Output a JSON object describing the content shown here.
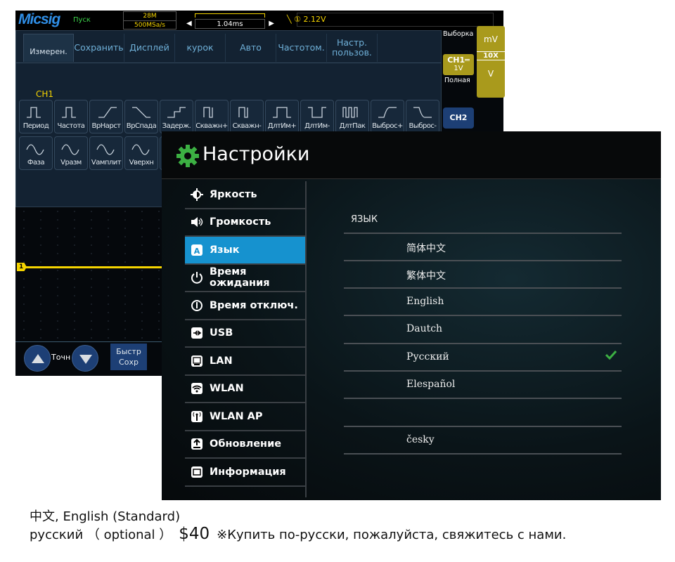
{
  "scope": {
    "brand": "Micsig",
    "run_state": "Пуск",
    "memory": "28M",
    "sample_rate": "500MSa/s",
    "timebase": "1.04ms",
    "trigger": "① 2.12V",
    "tabs": [
      "Измерен.",
      "Сохранить",
      "Дисплей",
      "курок",
      "Авто",
      "Частотом.",
      "Настр. пользов."
    ],
    "channel_label": "CH1",
    "measurements_row1": [
      "Период",
      "Частота",
      "ВрНарст",
      "ВрСпада",
      "Задерж.",
      "Скважн+",
      "Скважн-",
      "ДлтИм+",
      "ДлтИм-",
      "ДлтПак",
      "Выброс+",
      "Выброс-"
    ],
    "measurements_row2": [
      "Фаза",
      "Vразм",
      "Vамплит",
      "Vверхн"
    ],
    "side": {
      "acq_label": "Выборка",
      "ch1": "CH1═",
      "ch1_scale": "1V",
      "bandwidth": "Полная",
      "unit_top": "mV",
      "probe": "10X",
      "unit_bottom": "V",
      "ch2": "CH2"
    },
    "trace_marker": "1",
    "fine_label": "Точн",
    "quick_save": "Быстр Сохр",
    "colors": {
      "ch1": "#f5d400",
      "accent_blue": "#1d3f75"
    }
  },
  "settings": {
    "title": "Настройки",
    "menu": [
      {
        "label": "Яркость",
        "icon": "brightness-icon"
      },
      {
        "label": "Громкость",
        "icon": "volume-icon"
      },
      {
        "label": "Язык",
        "icon": "language-icon",
        "selected": true
      },
      {
        "label": "Время ожидания",
        "icon": "power-icon"
      },
      {
        "label": "Время отключ.",
        "icon": "shutdown-icon"
      },
      {
        "label": "USB",
        "icon": "usb-icon"
      },
      {
        "label": "LAN",
        "icon": "lan-icon"
      },
      {
        "label": "WLAN",
        "icon": "wifi-icon"
      },
      {
        "label": "WLAN AP",
        "icon": "hotspot-icon"
      },
      {
        "label": "Обновление",
        "icon": "update-icon"
      },
      {
        "label": "Информация",
        "icon": "info-icon"
      }
    ],
    "language_header": "ЯЗЫК",
    "languages": [
      "简体中文",
      "繁体中文",
      "English",
      "Dautch",
      "Русский",
      "Elespañol",
      "",
      "česky"
    ],
    "selected_language": "Русский",
    "colors": {
      "selected": "#1692cf",
      "check": "#3cb043",
      "gear": "#3cb043"
    }
  },
  "caption": {
    "line1": "中文, English (Standard)",
    "line2_a": "русский （ optional ）",
    "price": "$40",
    "line2_b": "※Купить по-русски, пожалуйста, свяжитесь с нами."
  }
}
